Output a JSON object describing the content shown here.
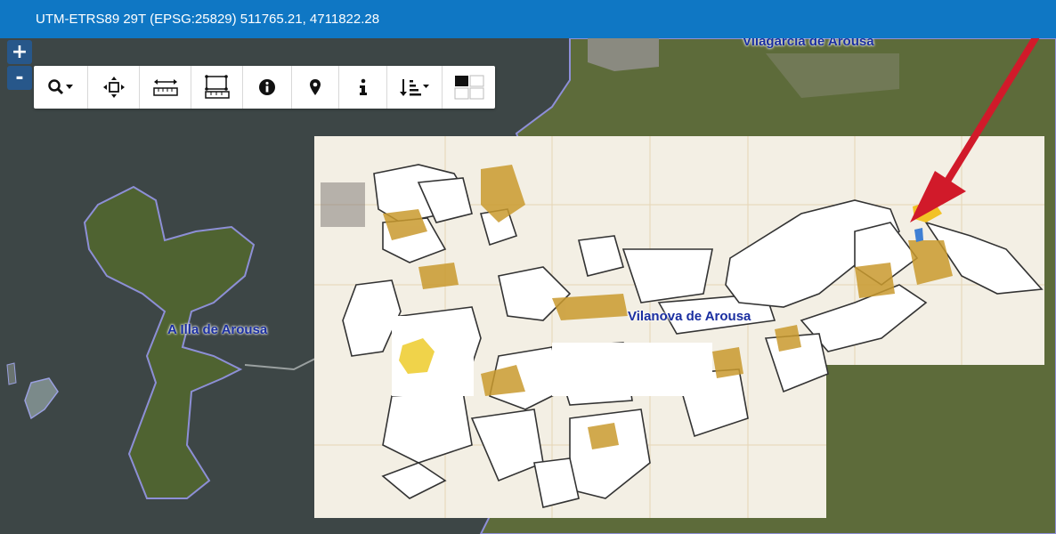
{
  "coords": {
    "text": "UTM-ETRS89 29T (EPSG:25829) 511765.21, 4711822.28"
  },
  "zoom": {
    "in_label": "+",
    "out_label": "-"
  },
  "toolbar": {
    "tools": [
      {
        "name": "search-tool",
        "icon": "magnifier-dropdown-icon"
      },
      {
        "name": "pan-tool",
        "icon": "move-arrows-icon"
      },
      {
        "name": "measure-distance-tool",
        "icon": "ruler-icon"
      },
      {
        "name": "measure-area-tool",
        "icon": "area-ruler-icon"
      },
      {
        "name": "info-tool",
        "icon": "info-circle-icon"
      },
      {
        "name": "locate-tool",
        "icon": "map-marker-icon"
      },
      {
        "name": "identify-tool",
        "icon": "info-icon"
      },
      {
        "name": "sort-tool",
        "icon": "sort-dropdown-icon"
      },
      {
        "name": "layer-switcher-tool",
        "icon": "grid-icon"
      }
    ]
  },
  "places": {
    "vilagarcia": "Vilagarcía de Arousa",
    "illa": "A Illa de Arousa",
    "vilanova": "Vilanova de Arousa"
  },
  "colors": {
    "topbar": "#0f77c4",
    "sea": "#3d4646",
    "land": "#5f6d3c",
    "overlay": "#f3efe6",
    "parcel_fill": "#ffffff",
    "orange_patch": "#c99a2e",
    "arrow": "#d11a2a"
  }
}
